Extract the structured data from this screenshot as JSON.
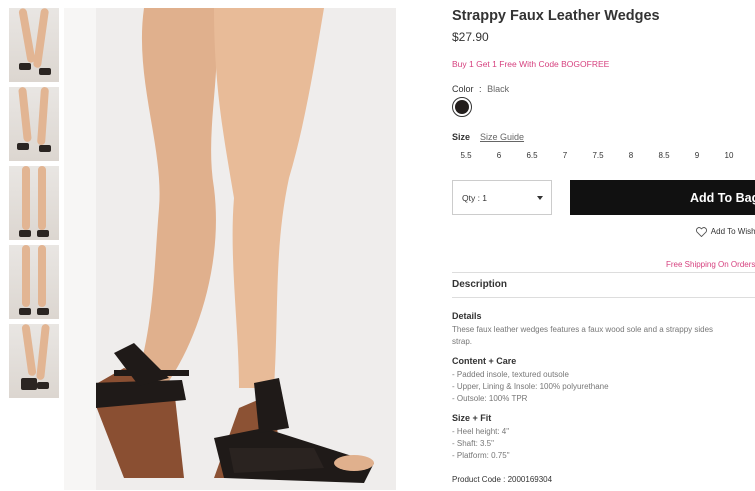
{
  "gallery": {
    "thumbnails": [
      "thumbnail-1",
      "thumbnail-2",
      "thumbnail-3",
      "thumbnail-4",
      "thumbnail-5"
    ]
  },
  "product": {
    "title": "Strappy Faux Leather Wedges",
    "price": "$27.90",
    "promo": "Buy 1 Get 1 Free With Code BOGOFREE",
    "color_label": "Color",
    "color_sep": ":",
    "color_value": "Black",
    "swatch_color": "#231e1c",
    "size_label": "Size",
    "size_guide": "Size Guide",
    "sizes": [
      "5.5",
      "6",
      "6.5",
      "7",
      "7.5",
      "8",
      "8.5",
      "9",
      "10"
    ],
    "qty_label": "Qty : 1",
    "add_button": "Add To Bag",
    "wishlist": "Add To Wishlist",
    "shipping": "Free Shipping On Orders",
    "description_heading": "Description",
    "details_title": "Details",
    "details_lines": [
      "These faux leather wedges features a faux wood sole and a strappy sides",
      "strap."
    ],
    "content_title": "Content + Care",
    "content_lines": [
      "- Padded insole, textured outsole",
      "- Upper, Lining & Insole: 100% polyurethane",
      "- Outsole: 100% TPR"
    ],
    "fit_title": "Size + Fit",
    "fit_lines": [
      "- Heel height: 4\"",
      "- Shaft: 3.5\"",
      "- Platform: 0.75\""
    ],
    "product_code": "Product Code : 2000169304"
  },
  "colors": {
    "accent_pink": "#d6417f",
    "button_black": "#111111"
  }
}
